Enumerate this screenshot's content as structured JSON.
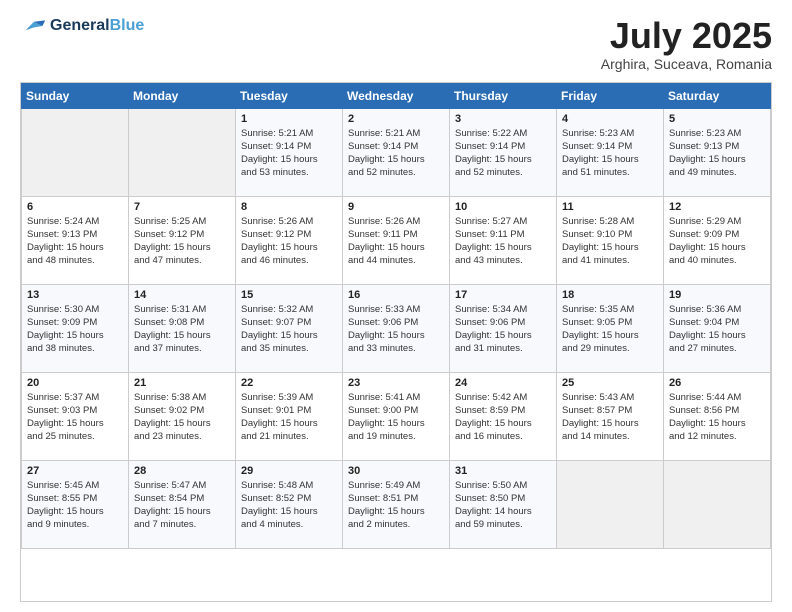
{
  "header": {
    "logo_line1": "General",
    "logo_line2": "Blue",
    "title": "July 2025",
    "subtitle": "Arghira, Suceava, Romania"
  },
  "calendar": {
    "days_of_week": [
      "Sunday",
      "Monday",
      "Tuesday",
      "Wednesday",
      "Thursday",
      "Friday",
      "Saturday"
    ],
    "weeks": [
      [
        {
          "day": "",
          "info": ""
        },
        {
          "day": "",
          "info": ""
        },
        {
          "day": "1",
          "info": "Sunrise: 5:21 AM\nSunset: 9:14 PM\nDaylight: 15 hours\nand 53 minutes."
        },
        {
          "day": "2",
          "info": "Sunrise: 5:21 AM\nSunset: 9:14 PM\nDaylight: 15 hours\nand 52 minutes."
        },
        {
          "day": "3",
          "info": "Sunrise: 5:22 AM\nSunset: 9:14 PM\nDaylight: 15 hours\nand 52 minutes."
        },
        {
          "day": "4",
          "info": "Sunrise: 5:23 AM\nSunset: 9:14 PM\nDaylight: 15 hours\nand 51 minutes."
        },
        {
          "day": "5",
          "info": "Sunrise: 5:23 AM\nSunset: 9:13 PM\nDaylight: 15 hours\nand 49 minutes."
        }
      ],
      [
        {
          "day": "6",
          "info": "Sunrise: 5:24 AM\nSunset: 9:13 PM\nDaylight: 15 hours\nand 48 minutes."
        },
        {
          "day": "7",
          "info": "Sunrise: 5:25 AM\nSunset: 9:12 PM\nDaylight: 15 hours\nand 47 minutes."
        },
        {
          "day": "8",
          "info": "Sunrise: 5:26 AM\nSunset: 9:12 PM\nDaylight: 15 hours\nand 46 minutes."
        },
        {
          "day": "9",
          "info": "Sunrise: 5:26 AM\nSunset: 9:11 PM\nDaylight: 15 hours\nand 44 minutes."
        },
        {
          "day": "10",
          "info": "Sunrise: 5:27 AM\nSunset: 9:11 PM\nDaylight: 15 hours\nand 43 minutes."
        },
        {
          "day": "11",
          "info": "Sunrise: 5:28 AM\nSunset: 9:10 PM\nDaylight: 15 hours\nand 41 minutes."
        },
        {
          "day": "12",
          "info": "Sunrise: 5:29 AM\nSunset: 9:09 PM\nDaylight: 15 hours\nand 40 minutes."
        }
      ],
      [
        {
          "day": "13",
          "info": "Sunrise: 5:30 AM\nSunset: 9:09 PM\nDaylight: 15 hours\nand 38 minutes."
        },
        {
          "day": "14",
          "info": "Sunrise: 5:31 AM\nSunset: 9:08 PM\nDaylight: 15 hours\nand 37 minutes."
        },
        {
          "day": "15",
          "info": "Sunrise: 5:32 AM\nSunset: 9:07 PM\nDaylight: 15 hours\nand 35 minutes."
        },
        {
          "day": "16",
          "info": "Sunrise: 5:33 AM\nSunset: 9:06 PM\nDaylight: 15 hours\nand 33 minutes."
        },
        {
          "day": "17",
          "info": "Sunrise: 5:34 AM\nSunset: 9:06 PM\nDaylight: 15 hours\nand 31 minutes."
        },
        {
          "day": "18",
          "info": "Sunrise: 5:35 AM\nSunset: 9:05 PM\nDaylight: 15 hours\nand 29 minutes."
        },
        {
          "day": "19",
          "info": "Sunrise: 5:36 AM\nSunset: 9:04 PM\nDaylight: 15 hours\nand 27 minutes."
        }
      ],
      [
        {
          "day": "20",
          "info": "Sunrise: 5:37 AM\nSunset: 9:03 PM\nDaylight: 15 hours\nand 25 minutes."
        },
        {
          "day": "21",
          "info": "Sunrise: 5:38 AM\nSunset: 9:02 PM\nDaylight: 15 hours\nand 23 minutes."
        },
        {
          "day": "22",
          "info": "Sunrise: 5:39 AM\nSunset: 9:01 PM\nDaylight: 15 hours\nand 21 minutes."
        },
        {
          "day": "23",
          "info": "Sunrise: 5:41 AM\nSunset: 9:00 PM\nDaylight: 15 hours\nand 19 minutes."
        },
        {
          "day": "24",
          "info": "Sunrise: 5:42 AM\nSunset: 8:59 PM\nDaylight: 15 hours\nand 16 minutes."
        },
        {
          "day": "25",
          "info": "Sunrise: 5:43 AM\nSunset: 8:57 PM\nDaylight: 15 hours\nand 14 minutes."
        },
        {
          "day": "26",
          "info": "Sunrise: 5:44 AM\nSunset: 8:56 PM\nDaylight: 15 hours\nand 12 minutes."
        }
      ],
      [
        {
          "day": "27",
          "info": "Sunrise: 5:45 AM\nSunset: 8:55 PM\nDaylight: 15 hours\nand 9 minutes."
        },
        {
          "day": "28",
          "info": "Sunrise: 5:47 AM\nSunset: 8:54 PM\nDaylight: 15 hours\nand 7 minutes."
        },
        {
          "day": "29",
          "info": "Sunrise: 5:48 AM\nSunset: 8:52 PM\nDaylight: 15 hours\nand 4 minutes."
        },
        {
          "day": "30",
          "info": "Sunrise: 5:49 AM\nSunset: 8:51 PM\nDaylight: 15 hours\nand 2 minutes."
        },
        {
          "day": "31",
          "info": "Sunrise: 5:50 AM\nSunset: 8:50 PM\nDaylight: 14 hours\nand 59 minutes."
        },
        {
          "day": "",
          "info": ""
        },
        {
          "day": "",
          "info": ""
        }
      ]
    ]
  }
}
